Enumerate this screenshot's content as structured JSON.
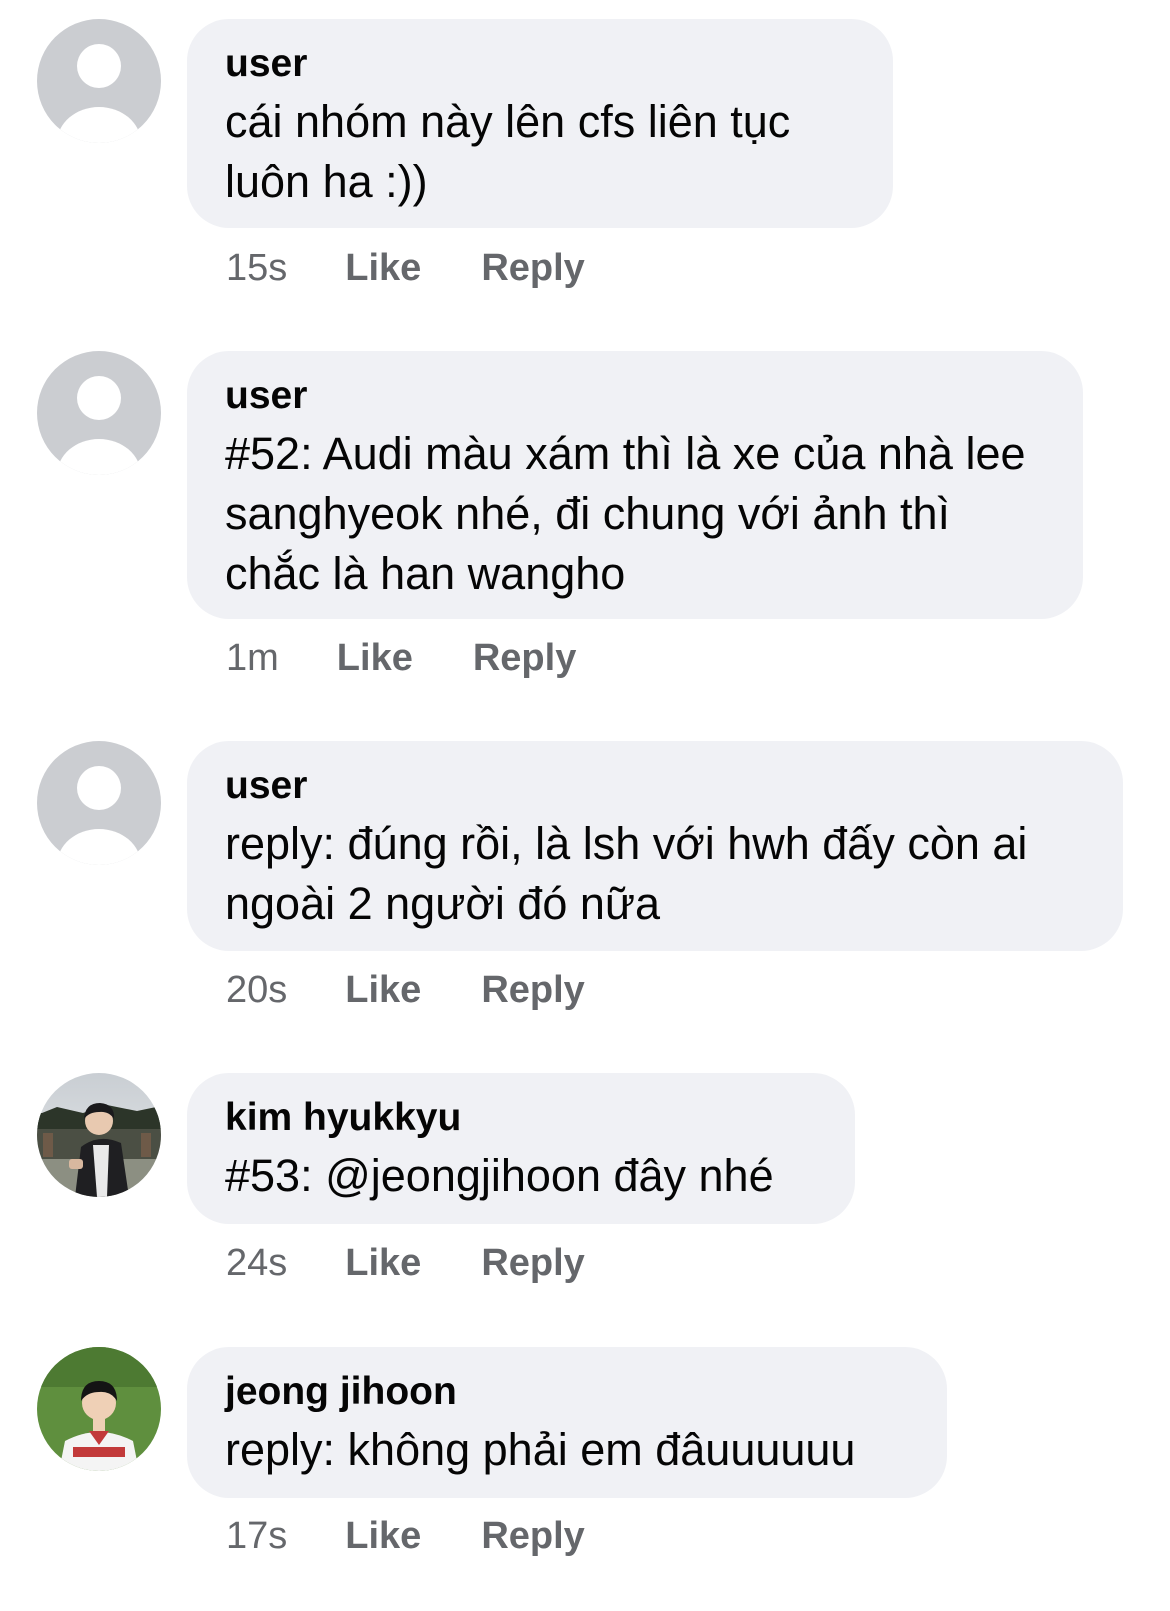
{
  "comments": [
    {
      "author": "user",
      "text": "cái nhóm này lên cfs liên tục luôn ha :))",
      "time": "15s",
      "like_label": "Like",
      "reply_label": "Reply",
      "avatar": "default-avatar-icon"
    },
    {
      "author": "user",
      "text": "#52: Audi màu xám thì là xe của nhà lee sanghyeok nhé, đi chung với ảnh thì chắc là han wangho",
      "time": "1m",
      "like_label": "Like",
      "reply_label": "Reply",
      "avatar": "default-avatar-icon"
    },
    {
      "author": "user",
      "text": "reply: đúng rồi, là lsh với hwh đấy còn ai ngoài 2 người đó nữa",
      "time": "20s",
      "like_label": "Like",
      "reply_label": "Reply",
      "avatar": "default-avatar-icon"
    },
    {
      "author": "kim hyukkyu",
      "text": "#53: @jeongjihoon đây nhé",
      "time": "24s",
      "like_label": "Like",
      "reply_label": "Reply",
      "avatar": "profile-photo"
    },
    {
      "author": "jeong jihoon",
      "text": "reply: không phải em đâuuuuuu",
      "time": "17s",
      "like_label": "Like",
      "reply_label": "Reply",
      "avatar": "profile-photo"
    }
  ],
  "colors": {
    "bubble_bg": "#f0f1f5",
    "text": "#050505",
    "secondary_text": "#65676b",
    "default_avatar_bg": "#d0d2d6"
  }
}
